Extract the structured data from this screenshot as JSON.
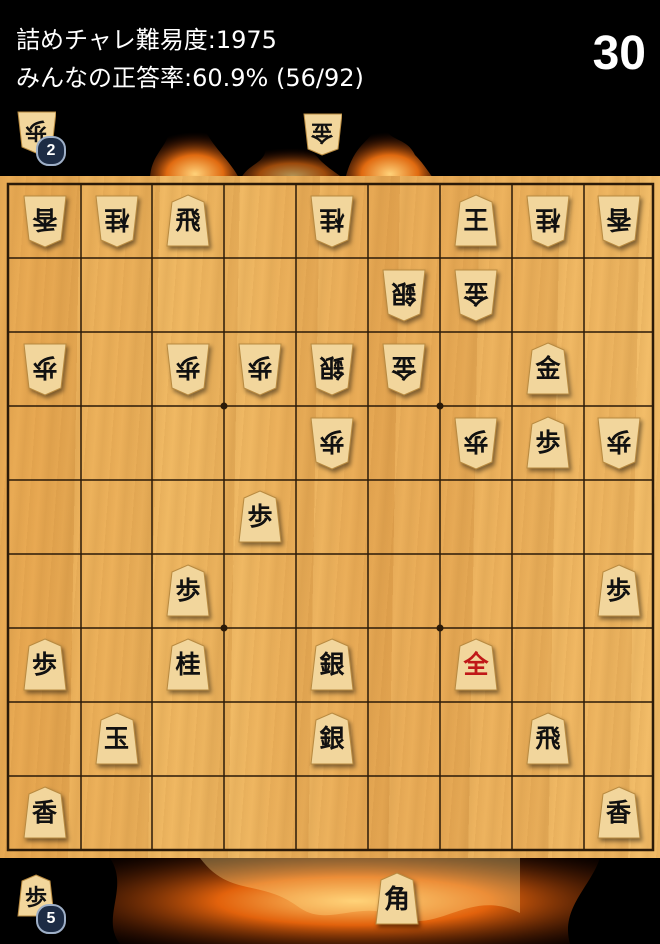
{
  "header": {
    "difficulty": "詰めチャレ難易度:1975",
    "correct_rate": "みんなの正答率:60.9% (56/92)",
    "timer": "30"
  },
  "colors": {
    "board": "#eeb25d",
    "grid_line": "#2b1a08",
    "piece_face": "#f2d69c",
    "promoted_text": "#c01818",
    "badge": "#1d2c45"
  },
  "hands": {
    "gote": [
      {
        "glyph": "歩",
        "count": "2"
      },
      {
        "glyph": "金"
      }
    ],
    "sente": [
      {
        "glyph": "歩",
        "count": "5"
      },
      {
        "glyph": "角"
      }
    ]
  },
  "board_pieces": [
    {
      "col": 0,
      "row": 0,
      "glyph": "香",
      "owner": "gote"
    },
    {
      "col": 1,
      "row": 0,
      "glyph": "桂",
      "owner": "gote"
    },
    {
      "col": 2,
      "row": 0,
      "glyph": "飛",
      "owner": "sente"
    },
    {
      "col": 4,
      "row": 0,
      "glyph": "桂",
      "owner": "gote"
    },
    {
      "col": 6,
      "row": 0,
      "glyph": "王",
      "owner": "sente"
    },
    {
      "col": 7,
      "row": 0,
      "glyph": "桂",
      "owner": "gote"
    },
    {
      "col": 8,
      "row": 0,
      "glyph": "香",
      "owner": "gote"
    },
    {
      "col": 5,
      "row": 1,
      "glyph": "銀",
      "owner": "gote"
    },
    {
      "col": 6,
      "row": 1,
      "glyph": "金",
      "owner": "gote"
    },
    {
      "col": 0,
      "row": 2,
      "glyph": "歩",
      "owner": "gote"
    },
    {
      "col": 2,
      "row": 2,
      "glyph": "歩",
      "owner": "gote"
    },
    {
      "col": 3,
      "row": 2,
      "glyph": "歩",
      "owner": "gote"
    },
    {
      "col": 4,
      "row": 2,
      "glyph": "銀",
      "owner": "gote"
    },
    {
      "col": 5,
      "row": 2,
      "glyph": "金",
      "owner": "gote"
    },
    {
      "col": 7,
      "row": 2,
      "glyph": "金",
      "owner": "sente"
    },
    {
      "col": 4,
      "row": 3,
      "glyph": "歩",
      "owner": "gote"
    },
    {
      "col": 6,
      "row": 3,
      "glyph": "歩",
      "owner": "gote"
    },
    {
      "col": 7,
      "row": 3,
      "glyph": "歩",
      "owner": "sente"
    },
    {
      "col": 8,
      "row": 3,
      "glyph": "歩",
      "owner": "gote"
    },
    {
      "col": 3,
      "row": 4,
      "glyph": "歩",
      "owner": "sente"
    },
    {
      "col": 2,
      "row": 5,
      "glyph": "歩",
      "owner": "sente"
    },
    {
      "col": 8,
      "row": 5,
      "glyph": "歩",
      "owner": "sente"
    },
    {
      "col": 0,
      "row": 6,
      "glyph": "歩",
      "owner": "sente"
    },
    {
      "col": 2,
      "row": 6,
      "glyph": "桂",
      "owner": "sente"
    },
    {
      "col": 4,
      "row": 6,
      "glyph": "銀",
      "owner": "sente"
    },
    {
      "col": 6,
      "row": 6,
      "glyph": "全",
      "owner": "sente",
      "promoted": true
    },
    {
      "col": 1,
      "row": 7,
      "glyph": "玉",
      "owner": "sente"
    },
    {
      "col": 4,
      "row": 7,
      "glyph": "銀",
      "owner": "sente"
    },
    {
      "col": 7,
      "row": 7,
      "glyph": "飛",
      "owner": "sente"
    },
    {
      "col": 0,
      "row": 8,
      "glyph": "香",
      "owner": "sente"
    },
    {
      "col": 8,
      "row": 8,
      "glyph": "香",
      "owner": "sente"
    }
  ]
}
